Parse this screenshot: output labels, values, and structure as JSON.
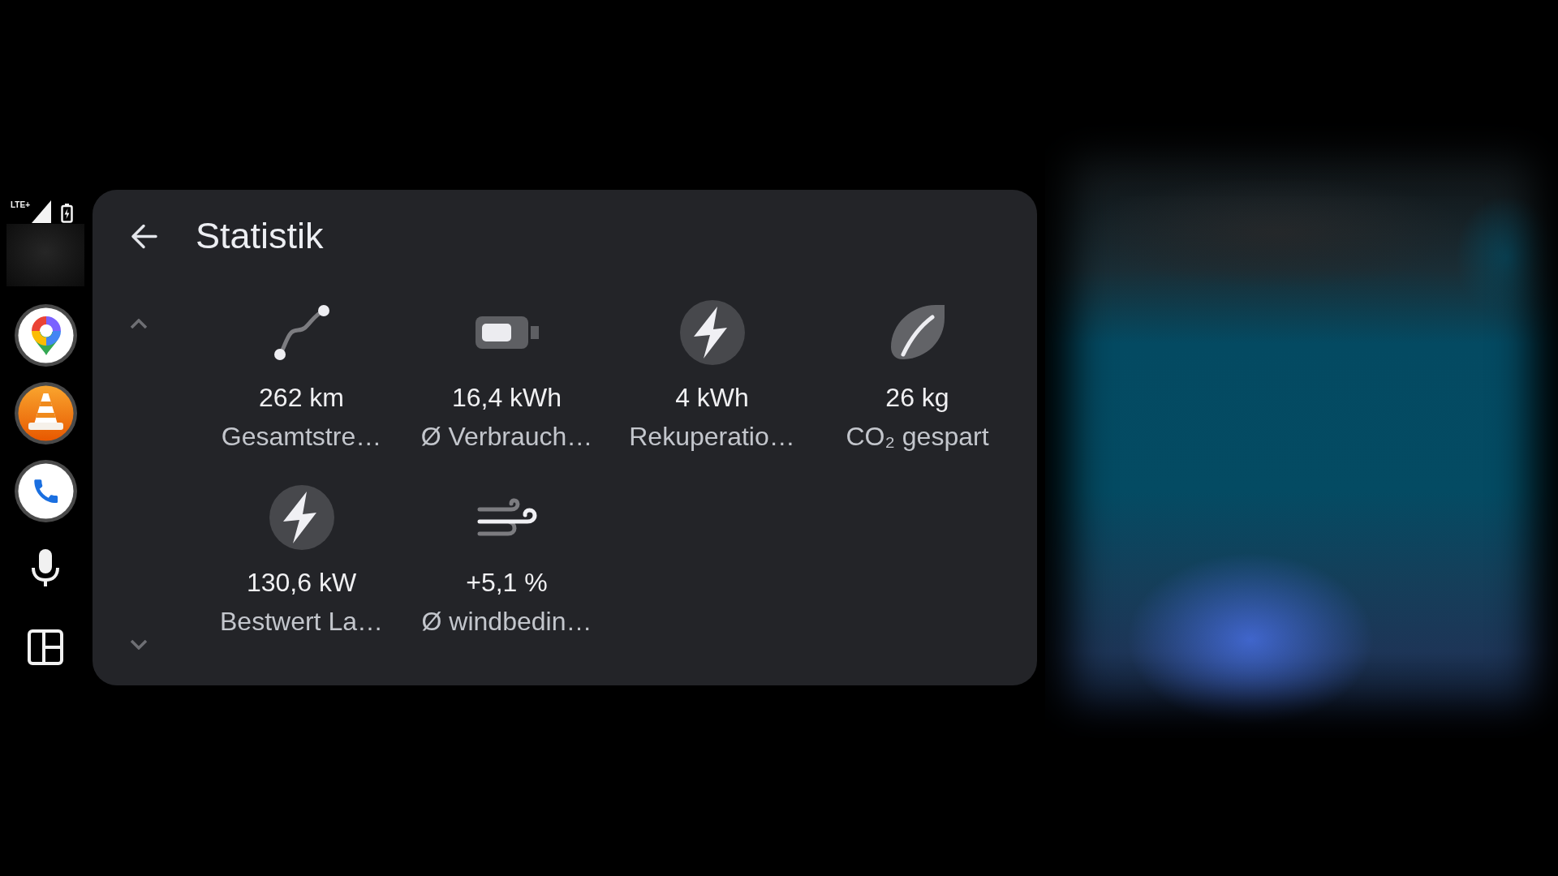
{
  "status": {
    "network": "LTE+"
  },
  "header": {
    "title": "Statistik"
  },
  "stats": [
    {
      "kind": "route",
      "value": "262 km",
      "label": "Gesamtstre…"
    },
    {
      "kind": "battery",
      "value": "16,4 kWh",
      "label": "Ø Verbrauch…"
    },
    {
      "kind": "bolt",
      "value": "4 kWh",
      "label": "Rekuperatio…"
    },
    {
      "kind": "leaf",
      "value": "26 kg",
      "label": "CO₂ gespart"
    },
    {
      "kind": "bolt",
      "value": "130,6 kW",
      "label": "Bestwert La…"
    },
    {
      "kind": "wind",
      "value": "+5,1 %",
      "label": "Ø windbedin…"
    }
  ]
}
